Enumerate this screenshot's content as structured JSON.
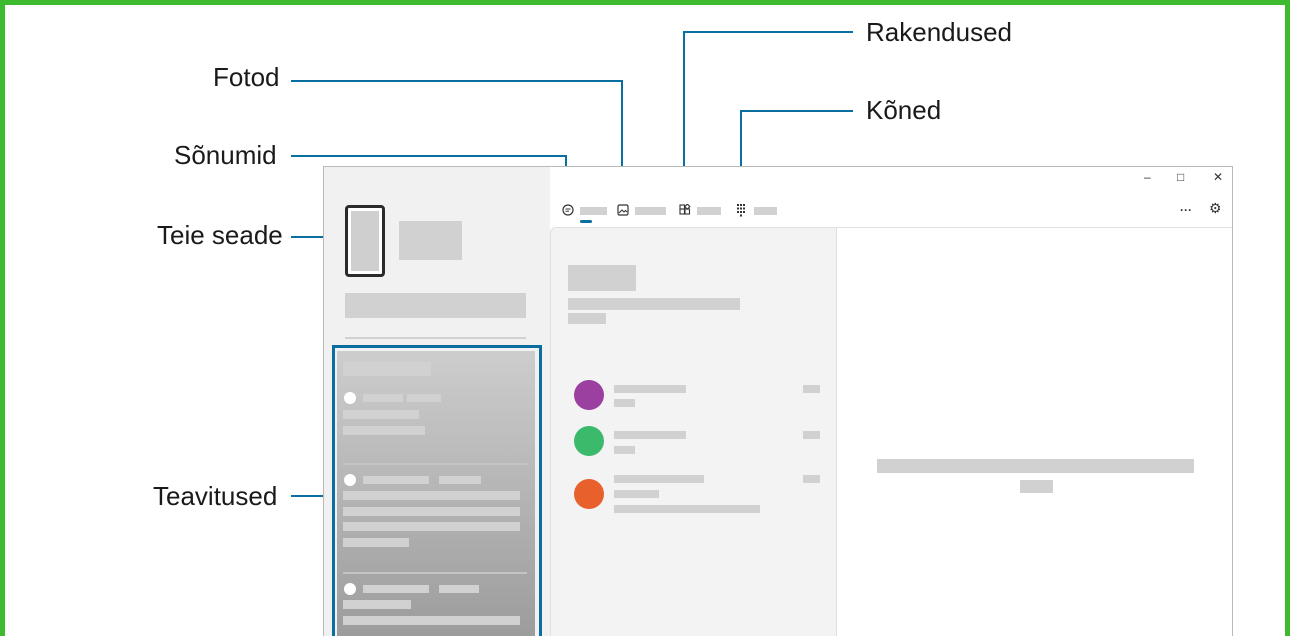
{
  "callouts": {
    "photos": "Fotod",
    "messages": "Sõnumid",
    "your_device": "Teie seade",
    "notifications": "Teavitused",
    "apps": "Rakendused",
    "calls": "Kõned"
  },
  "window": {
    "controls": {
      "minimize": "–",
      "maximize": "□",
      "close": "✕"
    },
    "toolbar": {
      "more": "···",
      "settings": "⚙"
    }
  },
  "colors": {
    "frame": "#3dba2e",
    "callout_line": "#0a6ea0",
    "avatar_1": "#9b3fa0",
    "avatar_2": "#3cba6c",
    "avatar_3": "#e8612c"
  },
  "icons": [
    "messages-icon",
    "photos-icon",
    "apps-icon",
    "calls-icon",
    "more-icon",
    "gear-icon",
    "phone-icon"
  ]
}
